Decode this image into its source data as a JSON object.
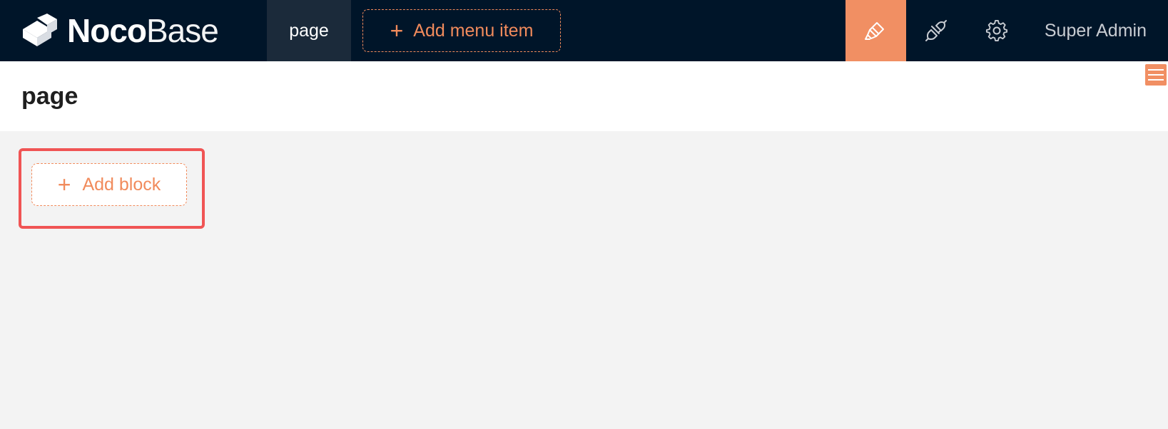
{
  "header": {
    "logo": {
      "bold": "Noco",
      "light": "Base"
    },
    "nav": {
      "active_page": "page"
    },
    "add_menu_item": {
      "icon": "+",
      "label": "Add menu item"
    },
    "icons": {
      "ui_editor": "highlighter-icon",
      "plugins": "plug-icon",
      "settings": "gear-icon"
    },
    "user": "Super Admin"
  },
  "page": {
    "title": "page",
    "menu_icon": "hamburger-icon"
  },
  "content": {
    "add_block": {
      "icon": "+",
      "label": "Add block"
    }
  },
  "colors": {
    "header_bg": "#001529",
    "accent": "#f18f63",
    "highlight": "#f05454",
    "content_bg": "#f3f3f3"
  }
}
